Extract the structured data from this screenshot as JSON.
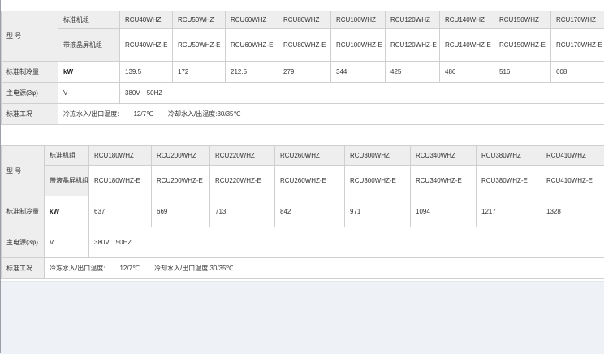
{
  "table1": {
    "model_label": "型 号",
    "row1_label": "标准机组",
    "row1": [
      "RCU40WHZ",
      "RCU50WHZ",
      "RCU60WHZ",
      "RCU80WHZ",
      "RCU100WHZ",
      "RCU120WHZ",
      "RCU140WHZ",
      "RCU150WHZ",
      "RCU170WHZ"
    ],
    "row2_label": "带液晶屏机组",
    "row2": [
      "RCU40WHZ-E",
      "RCU50WHZ-E",
      "RCU60WHZ-E",
      "RCU80WHZ-E",
      "RCU100WHZ-E",
      "RCU120WHZ-E",
      "RCU140WHZ-E",
      "RCU150WHZ-E",
      "RCU170WHZ-E"
    ],
    "cooling_label": "标准制冷量",
    "cooling_unit": "kW",
    "cooling_values": [
      "139.5",
      "172",
      "212.5",
      "279",
      "344",
      "425",
      "486",
      "516",
      "608"
    ],
    "power_label": "主电源(3φ)",
    "power_unit": "V",
    "power_voltage": "380V",
    "power_freq": "50HZ",
    "condition_label": "标准工况",
    "chilled_label": "冷冻水入/出口温度:",
    "chilled_value": "12/7℃",
    "cooling_water_label": "冷却水入/出温度:",
    "cooling_water_value": "30/35℃"
  },
  "table2": {
    "model_label": "型 号",
    "row1_label": "标准机组",
    "row1": [
      "RCU180WHZ",
      "RCU200WHZ",
      "RCU220WHZ",
      "RCU260WHZ",
      "RCU300WHZ",
      "RCU340WHZ",
      "RCU380WHZ",
      "RCU410WHZ"
    ],
    "row2_label": "带液晶屏机组",
    "row2": [
      "RCU180WHZ-E",
      "RCU200WHZ-E",
      "RCU220WHZ-E",
      "RCU260WHZ-E",
      "RCU300WHZ-E",
      "RCU340WHZ-E",
      "RCU380WHZ-E",
      "RCU410WHZ-E"
    ],
    "cooling_label": "标准制冷量",
    "cooling_unit": "kW",
    "cooling_values": [
      "637",
      "669",
      "713",
      "842",
      "971",
      "1094",
      "1217",
      "1328"
    ],
    "power_label": "主电源(3φ)",
    "power_unit": "V",
    "power_voltage": "380V",
    "power_freq": "50HZ",
    "condition_label": "标准工况",
    "chilled_label": "冷冻水入/出口温度:",
    "chilled_value": "12/7℃",
    "cooling_water_label": "冷却水入/出口温度:",
    "cooling_water_value": "30/35℃"
  }
}
